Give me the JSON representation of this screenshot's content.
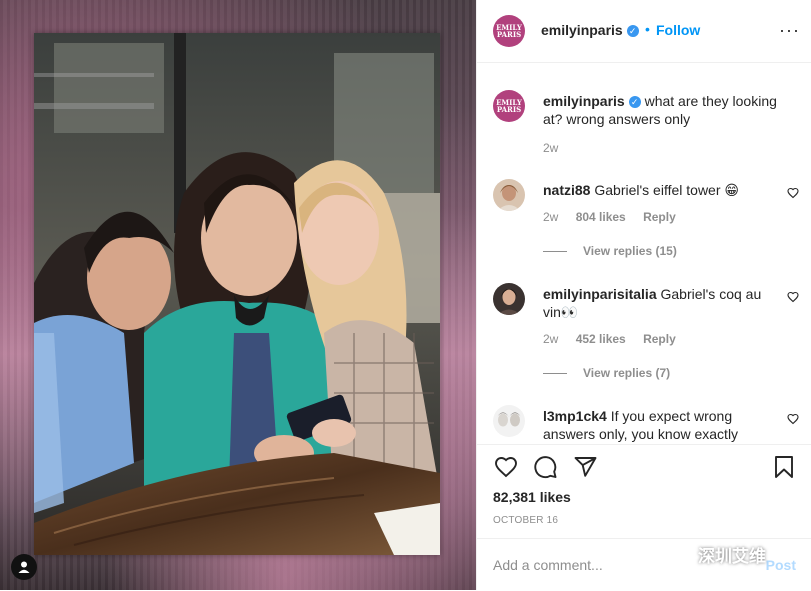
{
  "post": {
    "username": "emilyinparis",
    "verified": true,
    "follow_dot": "•",
    "follow_label": "Follow",
    "more_label": "···",
    "brand_avatar_text_1": "EMILY",
    "brand_avatar_text_2": "PARIS",
    "caption": "what are they looking at? wrong answers only",
    "caption_time": "2w",
    "likes": "82,381 likes",
    "date": "OCTOBER 16",
    "comment_placeholder": "Add a comment...",
    "post_label": "Post"
  },
  "comments": [
    {
      "username": "natzi88",
      "text": "Gabriel's eiffel tower 😁",
      "time": "2w",
      "likes": "804 likes",
      "reply": "Reply",
      "view_replies": "View replies (15)"
    },
    {
      "username": "emilyinparisitalia",
      "text": "Gabriel's coq au vin👀",
      "time": "2w",
      "likes": "452 likes",
      "reply": "Reply",
      "view_replies": "View replies (7)"
    },
    {
      "username": "l3mp1ck4",
      "text": "If you expect wrong answers only, you know exactly"
    }
  ],
  "watermark": {
    "text": "深圳艾维"
  },
  "icons": {
    "verified": "verified-badge-icon",
    "heart": "heart-icon",
    "comment": "comment-icon",
    "share": "share-icon",
    "save": "bookmark-icon",
    "user_tag": "user-icon",
    "watermark": "wechat-icon"
  },
  "colors": {
    "link_blue": "#0095f6",
    "brand_magenta": "#b1417d",
    "muted_gray": "#8e8e8e",
    "post_disabled": "#b3dbff"
  }
}
